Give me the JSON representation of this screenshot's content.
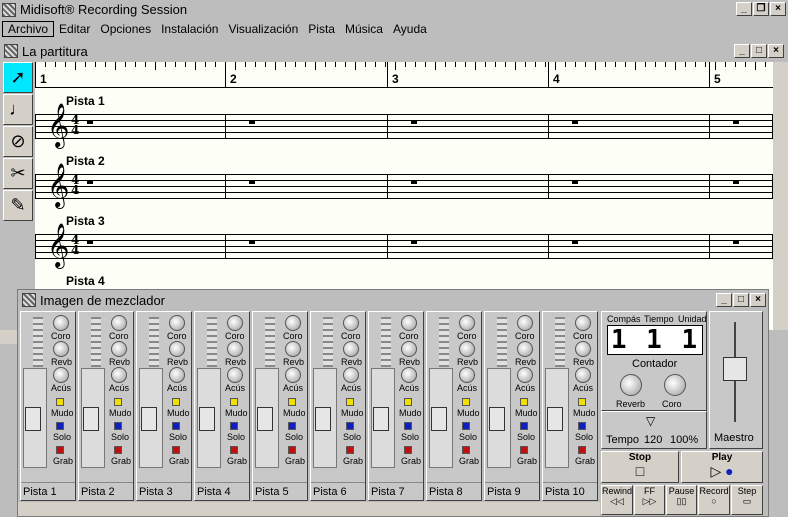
{
  "app": {
    "title": "Midisoft® Recording Session"
  },
  "menu": [
    "Archivo",
    "Editar",
    "Opciones",
    "Instalación",
    "Visualización",
    "Pista",
    "Música",
    "Ayuda"
  ],
  "score": {
    "title": "La partitura",
    "measures": [
      "1",
      "2",
      "3",
      "4",
      "5"
    ],
    "tracks": [
      "Pista 1",
      "Pista 2",
      "Pista 3",
      "Pista 4"
    ],
    "time_sig_top": "4",
    "time_sig_bottom": "4"
  },
  "mixer": {
    "title": "Imagen de mezclador",
    "knob_labels": {
      "coro": "Coro",
      "revb": "Revb",
      "acus": "Acús"
    },
    "led_labels": {
      "mudo": "Mudo",
      "solo": "Solo",
      "grab": "Grab"
    },
    "channels": [
      "Pista 1",
      "Pista 2",
      "Pista 3",
      "Pista 4",
      "Pista 5",
      "Pista 6",
      "Pista 7",
      "Pista 8",
      "Pista 9",
      "Pista 10"
    ]
  },
  "transport": {
    "col_compas": "Compás",
    "col_tiempo": "Tiempo",
    "col_unidad": "Unidad",
    "counter_display": "1  1  1",
    "contador": "Contador",
    "reverb": "Reverb",
    "coro": "Coro",
    "tempo_label": "Tempo",
    "tempo_value": "120",
    "percent": "100%",
    "maestro": "Maestro",
    "stop": "Stop",
    "play": "Play",
    "buttons": [
      "Rewind",
      "FF",
      "Pause",
      "Record",
      "Step"
    ]
  }
}
